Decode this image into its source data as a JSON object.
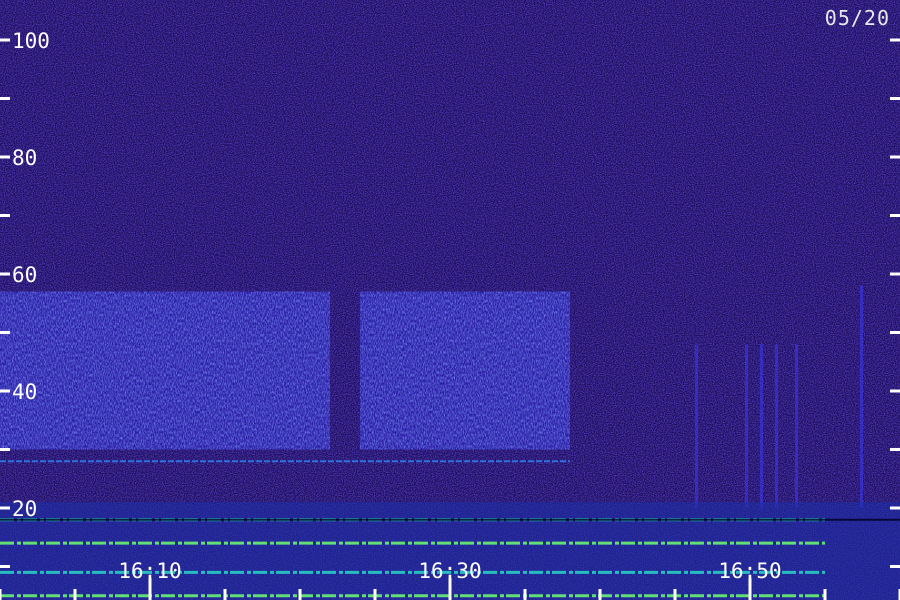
{
  "date_label": "05/20",
  "chart_data": {
    "type": "heatmap",
    "title": "",
    "xlabel": "",
    "ylabel": "",
    "x_tick_labels": [
      "16:10",
      "16:30",
      "16:50"
    ],
    "x_major_ticks_minutes": [
      10,
      30,
      50
    ],
    "x_minor_ticks_minutes": [
      0,
      5,
      15,
      20,
      25,
      35,
      40,
      45,
      55,
      60
    ],
    "x_range_minutes": [
      -5,
      55
    ],
    "y_tick_labels": [
      "100",
      "80",
      "60",
      "40",
      "20"
    ],
    "y_major_ticks": [
      100,
      80,
      60,
      40,
      20
    ],
    "y_minor_ticks": [
      90,
      70,
      50,
      30,
      10
    ],
    "y_range": [
      0,
      110
    ],
    "grid": false,
    "background_level": "low",
    "bands": [
      {
        "description": "broad enhanced region",
        "y_from": 30,
        "y_to": 57,
        "t_from_min": -5,
        "t_to_min": 22
      },
      {
        "description": "broad enhanced region",
        "y_from": 30,
        "y_to": 57,
        "t_from_min": 24,
        "t_to_min": 38
      }
    ],
    "lines": [
      {
        "y": 28,
        "t_from_min": -5,
        "t_to_min": 38
      },
      {
        "y": 18,
        "t_from_min": -5,
        "t_to_min": 55
      },
      {
        "y": 14,
        "t_from_min": -5,
        "t_to_min": 55
      },
      {
        "y": 9,
        "t_from_min": -5,
        "t_to_min": 55
      },
      {
        "y": 5,
        "t_from_min": -5,
        "t_to_min": 55
      }
    ],
    "colorscale": [
      "#0c0630",
      "#2c11a0",
      "#3a2cff",
      "#1e7df0",
      "#25e0d0",
      "#8cff60"
    ]
  }
}
